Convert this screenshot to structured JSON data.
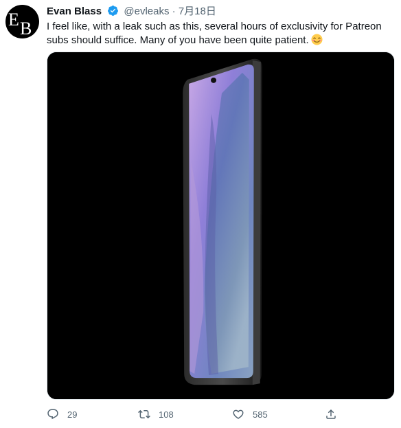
{
  "tweet": {
    "author_name": "Evan Blass",
    "author_handle": "@evleaks",
    "separator": "·",
    "date": "7月18日",
    "text": "I feel like, with a leak such as this, several hours of exclusivity for Patreon subs should suffice. Many of you have been quite patient.",
    "avatar_monogram": "EB",
    "verified": true
  },
  "actions": {
    "reply_count": "29",
    "retweet_count": "108",
    "like_count": "585"
  },
  "colors": {
    "verified_blue": "#1d9bf0",
    "icon_gray": "#536471",
    "media_bg": "#000000"
  },
  "icons": [
    "verified-badge-icon",
    "smile-emoji-icon",
    "reply-icon",
    "retweet-icon",
    "like-icon",
    "share-icon"
  ]
}
